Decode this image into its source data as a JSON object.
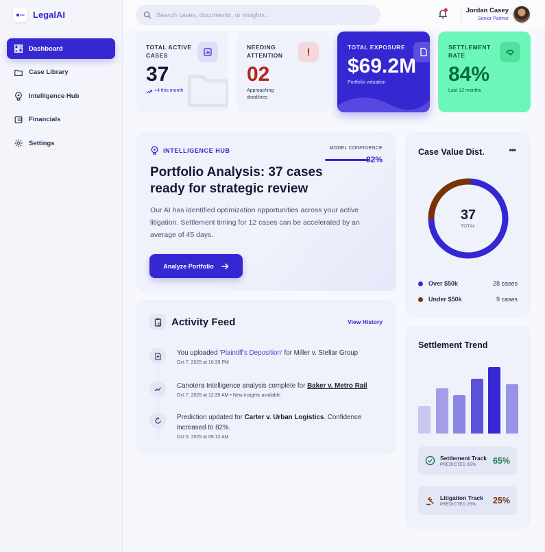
{
  "brand": {
    "name": "LegalAI"
  },
  "nav": {
    "items": [
      {
        "label": "Dashboard",
        "icon": "dashboard-icon",
        "active": true
      },
      {
        "label": "Case Library",
        "icon": "folder-icon",
        "active": false
      },
      {
        "label": "Intelligence Hub",
        "icon": "brain-icon",
        "active": false
      },
      {
        "label": "Financials",
        "icon": "wallet-icon",
        "active": false
      },
      {
        "label": "Settings",
        "icon": "gear-icon",
        "active": false
      }
    ]
  },
  "header": {
    "search_placeholder": "Search cases, documents, or insights...",
    "user_name": "Jordan Casey",
    "user_role": "Senior Partner"
  },
  "stats": [
    {
      "label": "TOTAL ACTIVE CASES",
      "value": "37",
      "sub": "+4 this month",
      "icon": "chart-icon"
    },
    {
      "label": "NEEDING ATTENTION",
      "value": "02",
      "sub": "Approaching deadlines",
      "icon": "alert-icon"
    },
    {
      "label": "TOTAL EXPOSURE",
      "value": "$69.2M",
      "sub": "Portfolio valuation",
      "icon": "document-icon"
    },
    {
      "label": "SETTLEMENT RATE",
      "value": "84%",
      "sub": "Last 12 months",
      "icon": "handshake-icon"
    }
  ],
  "hub": {
    "badge": "INTELLIGENCE HUB",
    "confidence_label": "MODEL CONFIDENCE",
    "confidence_value": "82%",
    "confidence_fraction": 0.82,
    "title": "Portfolio Analysis: 37 cases ready for strategic review",
    "description": "Our AI has identified optimization opportunities across your active litigation. Settlement timing for 12 cases can be accelerated by an average of 45 days.",
    "button_label": "Analyze Portfolio"
  },
  "activity": {
    "title": "Activity Feed",
    "link": "View History",
    "items": [
      {
        "pre": "You uploaded ",
        "highlight": "'Plaintiff's Deposition'",
        "post": " for Miller v. Stellar Group",
        "time": "Oct 7, 2025 at 10:39 PM",
        "icon": "upload-icon"
      },
      {
        "pre": "Canotera Intelligence analysis complete for ",
        "highlight": "Baker v. Metro Rail",
        "post": "",
        "time": "Oct 7, 2025 at 12:39 AM • New insights available",
        "icon": "trend-icon"
      },
      {
        "pre": "Prediction updated for ",
        "highlight": "Carter v. Urban Logistics",
        "post": ". Confidence increased to 82%.",
        "time": "Oct 5, 2025 at 09:12 AM",
        "icon": "refresh-icon"
      }
    ]
  },
  "distribution": {
    "title": "Case Value Dist.",
    "more": "•••",
    "total": "37",
    "total_label": "TOTAL",
    "legend": [
      {
        "label": "Over $50k",
        "count": "28 cases",
        "color": "#3527d2"
      },
      {
        "label": "Under $50k",
        "count": "9 cases",
        "color": "#7a3208"
      }
    ]
  },
  "chart_data": {
    "type": "pie",
    "categories": [
      "Over $50k",
      "Under $50k"
    ],
    "values": [
      28,
      9
    ],
    "title": "Case Value Dist."
  },
  "trend": {
    "title": "Settlement Trend",
    "bar_levels": [
      0.41,
      0.68,
      0.58,
      0.83,
      1.0,
      0.74
    ],
    "bar_colors": [
      "#c9c7f1",
      "#a29ee8",
      "#8b86e2",
      "#5b52db",
      "#3527d2",
      "#9893e6"
    ],
    "tracks": [
      {
        "name": "Settlement Track",
        "sub": "PREDICTED 65%",
        "value": "65%",
        "color": "#1f7a4d",
        "icon": "check-circle-icon"
      },
      {
        "name": "Litigation Track",
        "sub": "PREDICTED 25%",
        "value": "25%",
        "color": "#7a3208",
        "icon": "gavel-icon"
      }
    ]
  }
}
